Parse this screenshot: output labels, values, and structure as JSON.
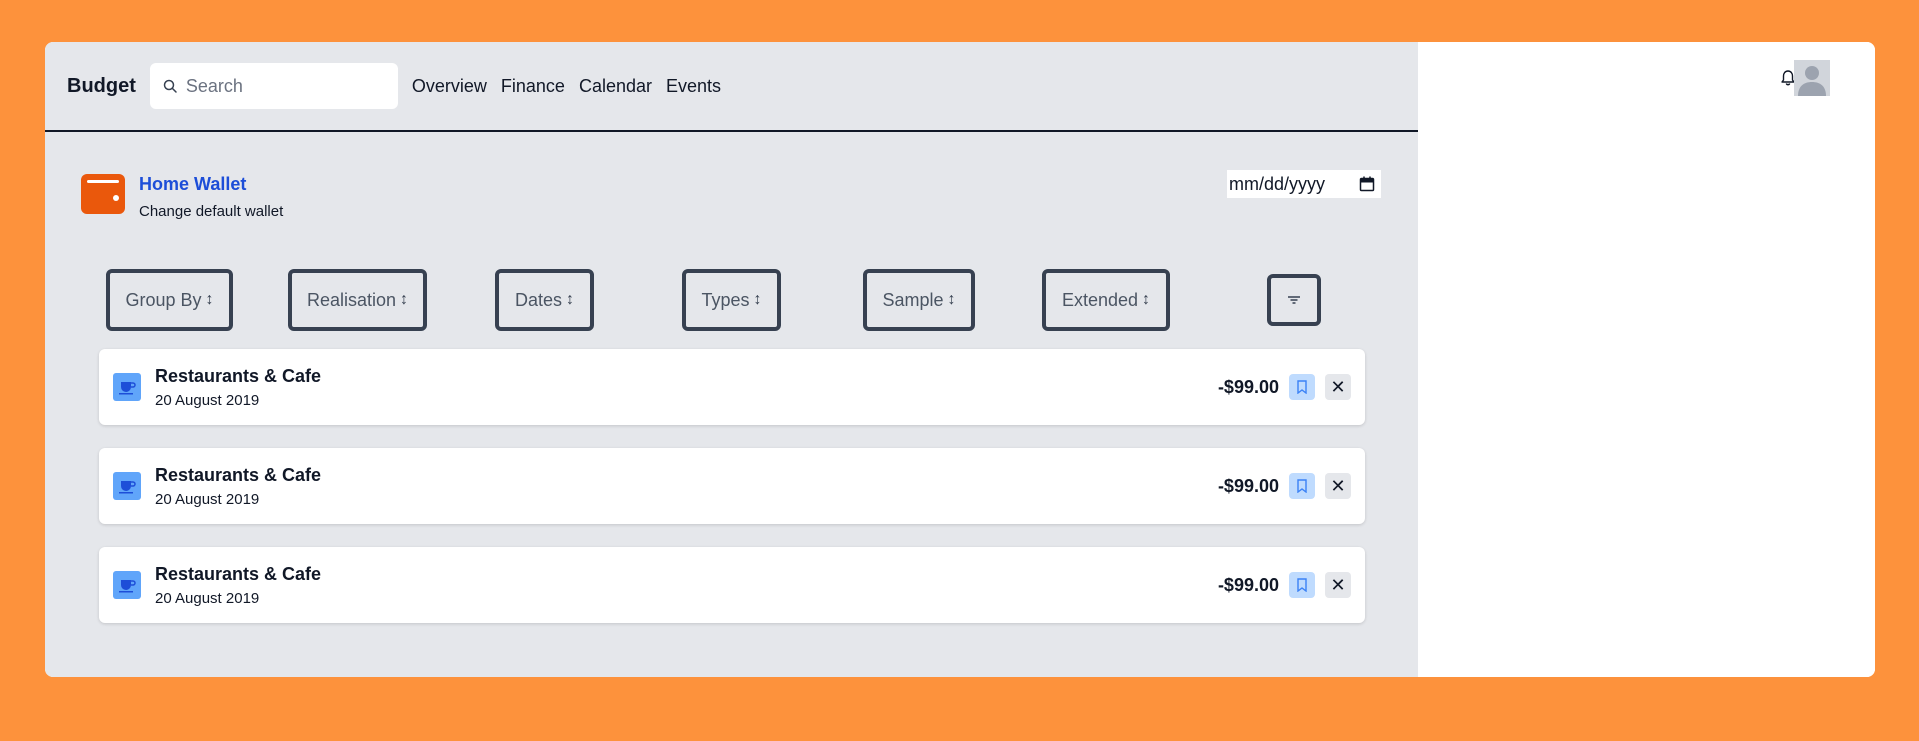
{
  "app": {
    "brand": "Budget"
  },
  "search": {
    "placeholder": "Search",
    "value": ""
  },
  "nav": {
    "items": [
      {
        "label": "Overview"
      },
      {
        "label": "Finance"
      },
      {
        "label": "Calendar"
      },
      {
        "label": "Events"
      }
    ]
  },
  "wallet": {
    "name": "Home Wallet",
    "change_label": "Change default wallet",
    "icon": "wallet-icon",
    "color": "#ea580c"
  },
  "date_filter": {
    "placeholder": "mm/dd/yyyy",
    "icon": "calendar-icon"
  },
  "filters": {
    "group_by": "Group By",
    "realisation": "Realisation",
    "dates": "Dates",
    "types": "Types",
    "sample": "Sample",
    "extended": "Extended",
    "sort_icon": "sort-arrows-icon",
    "filter_icon": "filter-icon"
  },
  "transactions": [
    {
      "category": "Restaurants & Cafe",
      "date": "20 August 2019",
      "amount": "-$99.00",
      "icon": "coffee-cup-icon"
    },
    {
      "category": "Restaurants & Cafe",
      "date": "20 August 2019",
      "amount": "-$99.00",
      "icon": "coffee-cup-icon"
    },
    {
      "category": "Restaurants & Cafe",
      "date": "20 August 2019",
      "amount": "-$99.00",
      "icon": "coffee-cup-icon"
    }
  ],
  "colors": {
    "background": "#fd923c",
    "main_panel": "#e5e7eb",
    "link": "#1d4ed8",
    "category_icon": "#60a5fa",
    "bookmark_button": "#bfdbfe"
  }
}
